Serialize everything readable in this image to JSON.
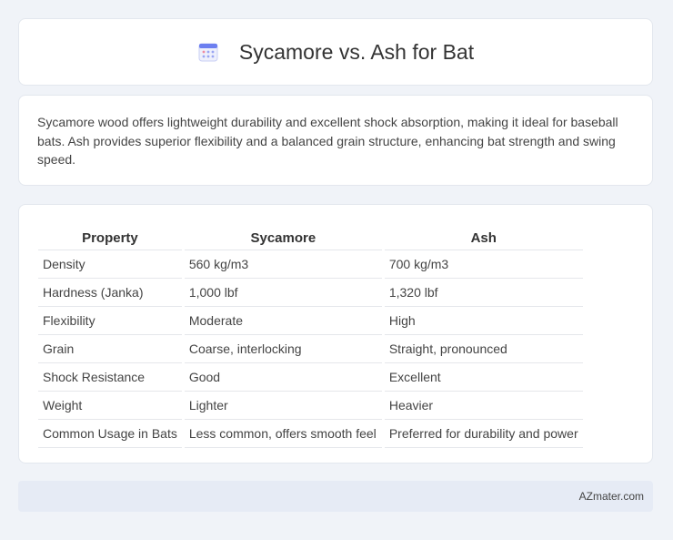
{
  "header": {
    "title": "Sycamore vs. Ash for Bat",
    "icon": "calendar-icon"
  },
  "intro": {
    "text": "Sycamore wood offers lightweight durability and excellent shock absorption, making it ideal for baseball bats. Ash provides superior flexibility and a balanced grain structure, enhancing bat strength and swing speed."
  },
  "table": {
    "headers": [
      "Property",
      "Sycamore",
      "Ash"
    ],
    "rows": [
      [
        "Density",
        "560 kg/m3",
        "700 kg/m3"
      ],
      [
        "Hardness (Janka)",
        "1,000 lbf",
        "1,320 lbf"
      ],
      [
        "Flexibility",
        "Moderate",
        "High"
      ],
      [
        "Grain",
        "Coarse, interlocking",
        "Straight, pronounced"
      ],
      [
        "Shock Resistance",
        "Good",
        "Excellent"
      ],
      [
        "Weight",
        "Lighter",
        "Heavier"
      ],
      [
        "Common Usage in Bats",
        "Less common, offers smooth feel",
        "Preferred for durability and power"
      ]
    ]
  },
  "footer": {
    "brand": "AZmater.com"
  },
  "colors": {
    "background": "#f0f3f8",
    "card": "#ffffff",
    "footer": "#e6ebf5",
    "icon_accent": "#6c7ff0"
  }
}
